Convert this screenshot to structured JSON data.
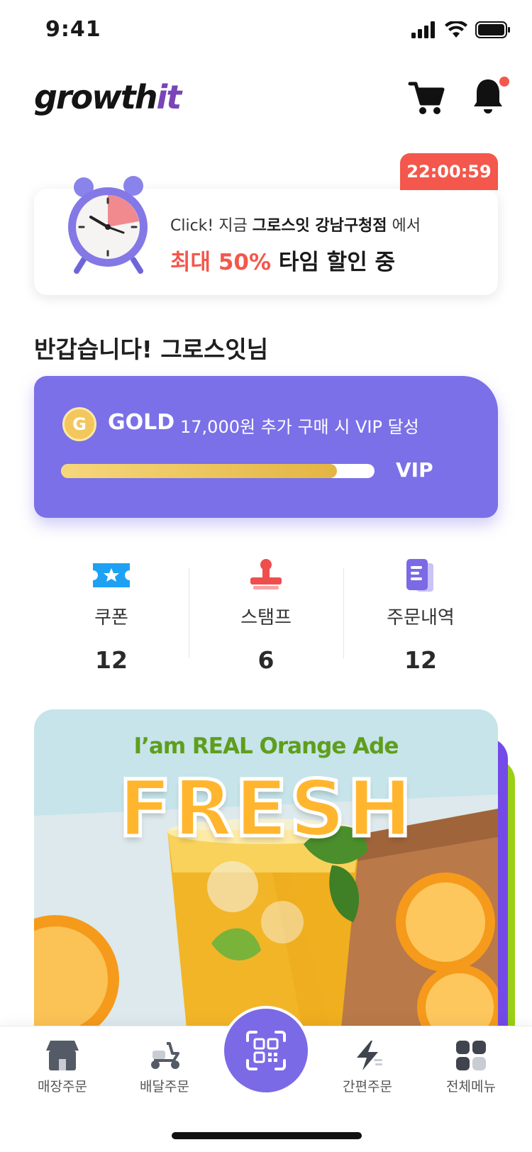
{
  "status_bar": {
    "time": "9:41"
  },
  "header": {
    "logo_main": "growth",
    "logo_accent": "it"
  },
  "promo": {
    "timer": "22:00:59",
    "line1_prefix": "Click! 지금 ",
    "line1_store": "그로스잇 강남구청점",
    "line1_suffix": " 에서",
    "line2_highlight": "최대 50%",
    "line2_rest": " 타임 할인 중"
  },
  "greeting": "반갑습니다! 그로스잇님",
  "membership": {
    "coin_letter": "G",
    "grade": "GOLD",
    "description": "17,000원 추가 구매 시 VIP 달성",
    "progress": 0.88,
    "target": "VIP",
    "colors": {
      "card": "#7b70e8",
      "coin": "#f3c75d"
    }
  },
  "stats": [
    {
      "icon": "coupon-icon",
      "label": "쿠폰",
      "value": "12"
    },
    {
      "icon": "stamp-icon",
      "label": "스탬프",
      "value": "6"
    },
    {
      "icon": "order-history-icon",
      "label": "주문내역",
      "value": "12"
    }
  ],
  "banner": {
    "eyebrow": "I’am REAL Orange Ade",
    "title": "FRESH"
  },
  "bottom_nav": [
    {
      "icon": "store-icon",
      "label": "매장주문"
    },
    {
      "icon": "scooter-icon",
      "label": "배달주문"
    },
    {
      "icon": "qr-code-icon",
      "label": ""
    },
    {
      "icon": "lightning-icon",
      "label": "간편주문"
    },
    {
      "icon": "grid-menu-icon",
      "label": "전체메뉴"
    }
  ]
}
